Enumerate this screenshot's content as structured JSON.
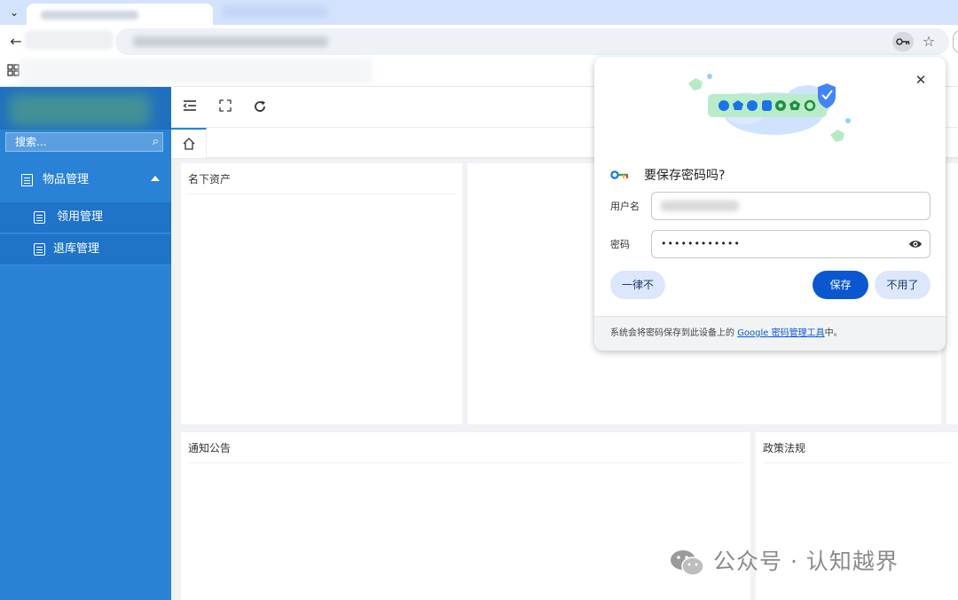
{
  "browser": {
    "password_dialog": {
      "title": "要保存密码吗?",
      "username_label": "用户名",
      "password_label": "密码",
      "password_value": "••••••••••••",
      "never_button": "一律不",
      "save_button": "保存",
      "no_thanks_button": "不用了",
      "footer_prefix": "系统会将密码保存到此设备上的 ",
      "footer_link": "Google 密码管理工具",
      "footer_suffix": "中。"
    }
  },
  "sidebar": {
    "search_placeholder": "搜索...",
    "group_label": "物品管理",
    "items": [
      {
        "label": "领用管理"
      },
      {
        "label": "退库管理"
      }
    ]
  },
  "main": {
    "cards": {
      "assets_title": "名下资产",
      "notice_title": "通知公告",
      "policy_title": "政策法规"
    }
  },
  "watermark": {
    "text": "公众号 · 认知越界"
  },
  "colors": {
    "sidebar": "#2a82d6",
    "sidebar_active": "#1f73c9",
    "chrome_tab_strip": "#d3e3fd",
    "save_button": "#0b57d0"
  }
}
